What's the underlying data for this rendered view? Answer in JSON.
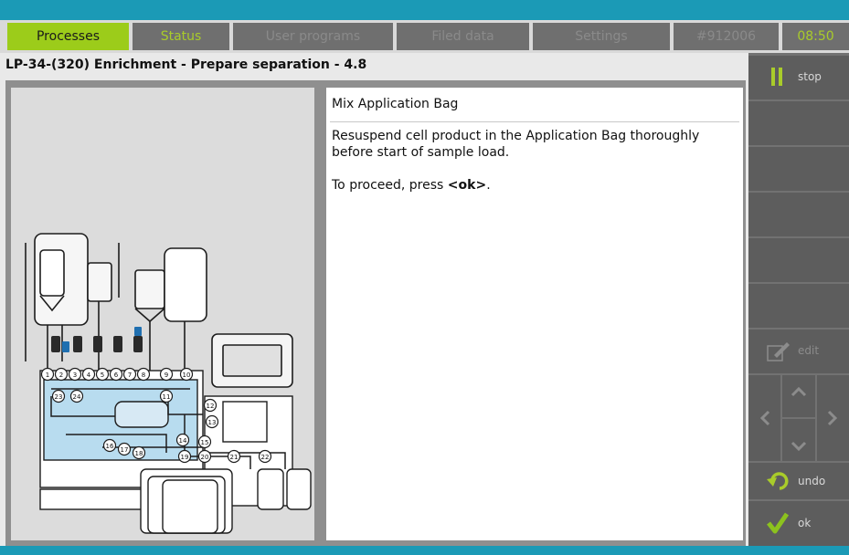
{
  "nav": {
    "tabs": [
      {
        "label": "Processes"
      },
      {
        "label": "Status"
      },
      {
        "label": "User programs"
      },
      {
        "label": "Filed data"
      },
      {
        "label": "Settings"
      },
      {
        "label": "#912006"
      },
      {
        "label": "08:50"
      }
    ]
  },
  "page": {
    "title": "LP-34-(320) Enrichment - Prepare separation - 4.8"
  },
  "message": {
    "heading": "Mix Application Bag",
    "body": "Resuspend cell product in the Application Bag thoroughly before start of sample load.",
    "proceed_prefix": "To proceed, press ",
    "proceed_key": "<ok>",
    "proceed_suffix": "."
  },
  "sidebar": {
    "stop_label": "stop",
    "edit_label": "edit",
    "undo_label": "undo",
    "ok_label": "ok"
  },
  "diagram": {
    "port_numbers": [
      "1",
      "2",
      "3",
      "4",
      "5",
      "6",
      "7",
      "8",
      "9",
      "10",
      "11",
      "12",
      "13",
      "14",
      "15",
      "16",
      "17",
      "18",
      "19",
      "20",
      "21",
      "22",
      "23",
      "24"
    ]
  },
  "colors": {
    "accent_bar": "#1b9ab6",
    "active_tab": "#9ccc1a",
    "ok_check": "#8cc21e"
  }
}
